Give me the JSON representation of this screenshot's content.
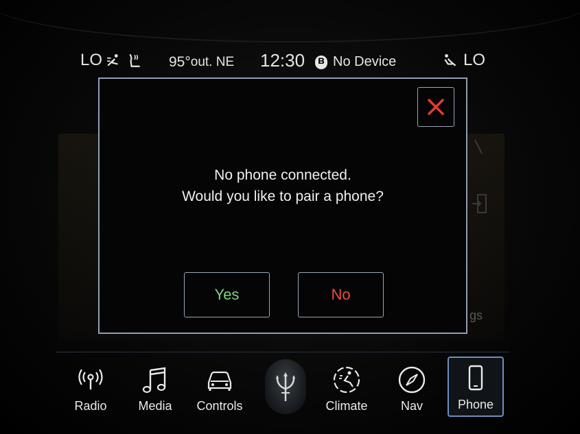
{
  "status_bar": {
    "left_temp": "LO",
    "outside_temp": "95°",
    "outside_suffix": "out. NE",
    "time": "12:30",
    "bluetooth_status": "No Device",
    "right_temp": "LO"
  },
  "background": {
    "partial_text": "gs"
  },
  "dialog": {
    "line1": "No phone connected.",
    "line2": "Would you like to pair a phone?",
    "yes_label": "Yes",
    "no_label": "No"
  },
  "nav": {
    "items": [
      {
        "label": "Radio",
        "icon": "radio-icon"
      },
      {
        "label": "Media",
        "icon": "music-note-icon"
      },
      {
        "label": "Controls",
        "icon": "car-icon"
      },
      {
        "label": "Climate",
        "icon": "climate-icon"
      },
      {
        "label": "Nav",
        "icon": "compass-icon"
      },
      {
        "label": "Phone",
        "icon": "phone-icon"
      }
    ],
    "active": "Phone"
  },
  "colors": {
    "yes": "#7ed37a",
    "no": "#ef4a3e",
    "close": "#e53935",
    "border": "#8fa0b4",
    "active_nav": "#6e8fc2"
  }
}
